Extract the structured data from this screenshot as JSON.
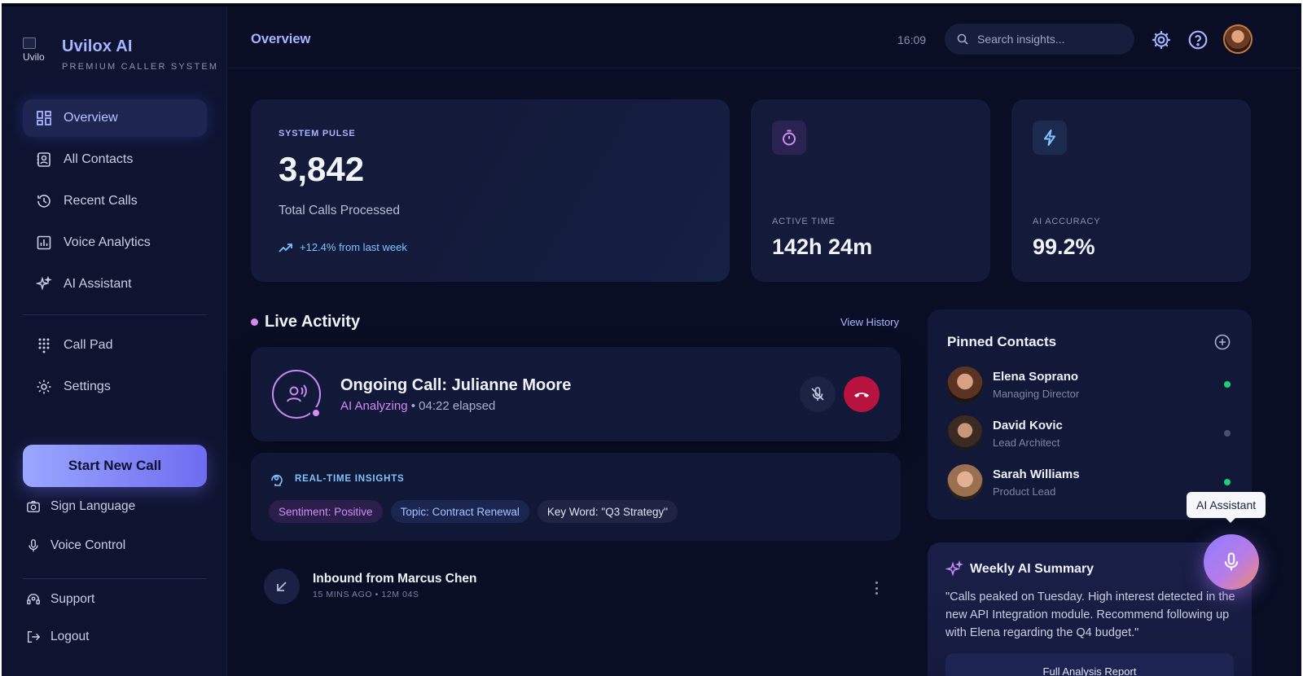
{
  "brand": {
    "name": "Uvilox AI",
    "subtitle": "PREMIUM CALLER SYSTEM",
    "logo_alt": "Uvilo"
  },
  "nav": {
    "items": [
      {
        "label": "Overview",
        "icon": "dashboard-icon",
        "active": true
      },
      {
        "label": "All Contacts",
        "icon": "contacts-icon"
      },
      {
        "label": "Recent Calls",
        "icon": "history-icon"
      },
      {
        "label": "Voice Analytics",
        "icon": "analytics-icon"
      },
      {
        "label": "AI Assistant",
        "icon": "sparkle-icon"
      },
      {
        "label": "Call Pad",
        "icon": "dialpad-icon"
      },
      {
        "label": "Settings",
        "icon": "gear-icon"
      }
    ],
    "start_call": "Start New Call",
    "extra": [
      {
        "label": "Sign Language",
        "icon": "camera-icon"
      },
      {
        "label": "Voice Control",
        "icon": "mic-icon"
      }
    ],
    "footer": [
      {
        "label": "Support",
        "icon": "support-icon"
      },
      {
        "label": "Logout",
        "icon": "logout-icon"
      }
    ]
  },
  "header": {
    "title": "Overview",
    "time": "16:09",
    "search_placeholder": "Search insights..."
  },
  "stats": {
    "pulse": {
      "label": "SYSTEM PULSE",
      "value": "3,842",
      "desc": "Total Calls Processed",
      "trend": "+12.4% from last week"
    },
    "active_time": {
      "label": "ACTIVE TIME",
      "value": "142h 24m"
    },
    "accuracy": {
      "label": "AI ACCURACY",
      "value": "99.2%"
    }
  },
  "live": {
    "title": "Live Activity",
    "view_history": "View History",
    "call": {
      "title": "Ongoing Call: Julianne Moore",
      "status": "AI Analyzing",
      "elapsed": "• 04:22 elapsed"
    },
    "insights": {
      "label": "REAL-TIME INSIGHTS",
      "tags": [
        "Sentiment: Positive",
        "Topic: Contract Renewal",
        "Key Word: \"Q3 Strategy\""
      ]
    },
    "inbound": {
      "name": "Inbound from Marcus Chen",
      "meta": "15 MINS AGO • 12M 04S"
    }
  },
  "pinned": {
    "title": "Pinned Contacts",
    "contacts": [
      {
        "name": "Elena Soprano",
        "role": "Managing Director",
        "status_color": "#1fcf7a"
      },
      {
        "name": "David Kovic",
        "role": "Lead Architect",
        "status_color": "#4a5072"
      },
      {
        "name": "Sarah Williams",
        "role": "Product Lead",
        "status_color": "#1fcf7a"
      }
    ]
  },
  "assistant": {
    "tooltip": "AI Assistant"
  },
  "summary": {
    "title": "Weekly AI Summary",
    "text": "\"Calls peaked on Tuesday. High interest detected in the new API Integration module. Recommend following up with Elena regarding the Q4 budget.\"",
    "button": "Full Analysis Report"
  },
  "colors": {
    "accent": "#a8b4ff",
    "purple": "#cf8cf3",
    "cyan": "#7fc4ff",
    "danger": "#b8133e",
    "online": "#1fcf7a",
    "background": "#090e24"
  }
}
